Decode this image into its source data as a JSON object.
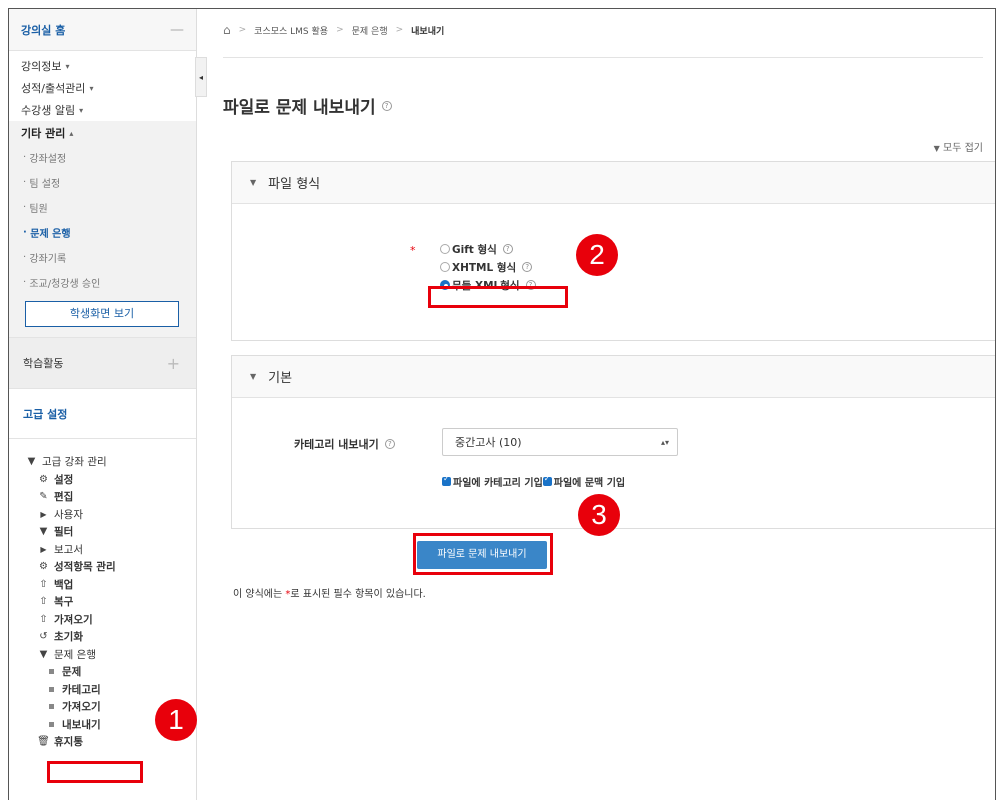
{
  "sidebar": {
    "home": "강의실 홈",
    "menu": [
      {
        "label": "강의정보",
        "caret": "▾"
      },
      {
        "label": "성적/출석관리",
        "caret": "▾"
      },
      {
        "label": "수강생 알림",
        "caret": "▾"
      }
    ],
    "other": {
      "label": "기타 관리",
      "caret": "▴",
      "items": [
        "강좌설정",
        "팀 설정",
        "팀원",
        "문제 은행",
        "강좌기록",
        "조교/청강생 승인"
      ],
      "active_index": 3
    },
    "student_view_button": "학생화면 보기",
    "learning": "학습활동",
    "advanced": "고급 설정",
    "tree": {
      "root": "고급 강좌 관리",
      "settings": "설정",
      "edit": "편집",
      "users": "사용자",
      "filter": "필터",
      "reports": "보고서",
      "grade_items": "성적항목 관리",
      "backup": "백업",
      "restore": "복구",
      "import": "가져오기",
      "reset": "초기화",
      "question_bank": "문제 은행",
      "qb_items": [
        "문제",
        "카테고리",
        "가져오기",
        "내보내기"
      ],
      "trash": "휴지통"
    }
  },
  "breadcrumb": {
    "items": [
      "코스모스 LMS 활용",
      "문제 은행",
      "내보내기"
    ]
  },
  "page": {
    "title": "파일로 문제 내보내기",
    "collapse_all": "모두 접기"
  },
  "format_section": {
    "title": "파일 형식",
    "options": [
      "Gift 형식",
      "XHTML 형식",
      "무들 XML형식"
    ],
    "selected_index": 2
  },
  "general_section": {
    "title": "기본",
    "category_label": "카테고리 내보내기",
    "category_value": "중간고사 (10)",
    "checkboxes": [
      "파일에 카테고리 기입",
      "파일에 문맥 기입"
    ]
  },
  "submit_label": "파일로 문제 내보내기",
  "required_note": {
    "prefix": "이 양식에는 ",
    "star": "*",
    "suffix": "로 표시된 필수 항목이 있습니다."
  },
  "markers": [
    "1",
    "2",
    "3"
  ],
  "colors": {
    "accent_blue": "#1a5fa6",
    "button_blue": "#3a86c8",
    "highlight_red": "#e8000b"
  }
}
